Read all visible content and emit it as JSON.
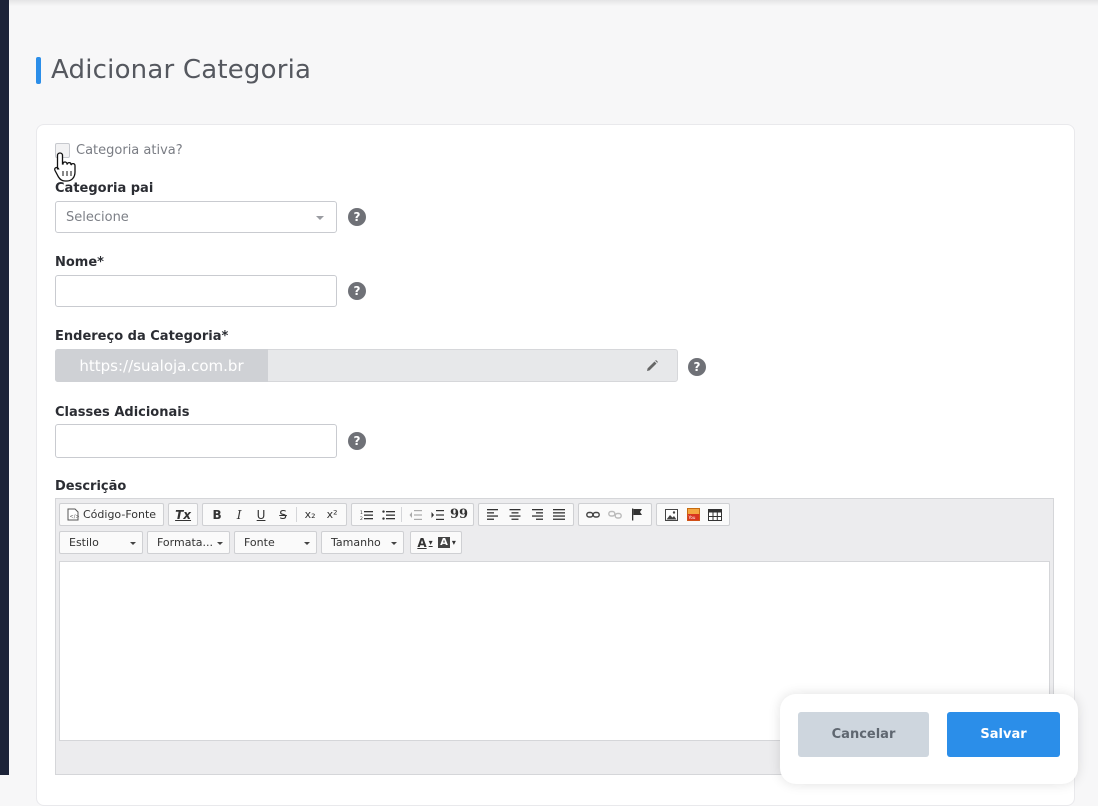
{
  "page": {
    "title": "Adicionar Categoria"
  },
  "form": {
    "active_checkbox_label": "Categoria ativa?",
    "active_checked": false,
    "parent": {
      "label": "Categoria pai",
      "selected": "Selecione"
    },
    "name": {
      "label": "Nome*",
      "value": ""
    },
    "address": {
      "label": "Endereço da Categoria*",
      "prefix": "https://sualoja.com.br",
      "value": ""
    },
    "classes": {
      "label": "Classes Adicionais",
      "value": ""
    },
    "description": {
      "label": "Descrição"
    },
    "help_symbol": "?"
  },
  "editor": {
    "source_button": "Código-Fonte",
    "buttons": {
      "remove_format": "Tx",
      "bold": "B",
      "italic": "I",
      "underline": "U",
      "strike": "S",
      "subscript": "x₂",
      "superscript": "x²",
      "quote": "99"
    },
    "dropdowns": {
      "style": "Estilo",
      "format": "Formata...",
      "font": "Fonte",
      "size": "Tamanho"
    },
    "text_color": "A",
    "bg_color": "A"
  },
  "actions": {
    "cancel": "Cancelar",
    "save": "Salvar"
  },
  "colors": {
    "accent": "#2b8ee9",
    "sidebar": "#1c2338",
    "cancel_bg": "#ced6de"
  }
}
